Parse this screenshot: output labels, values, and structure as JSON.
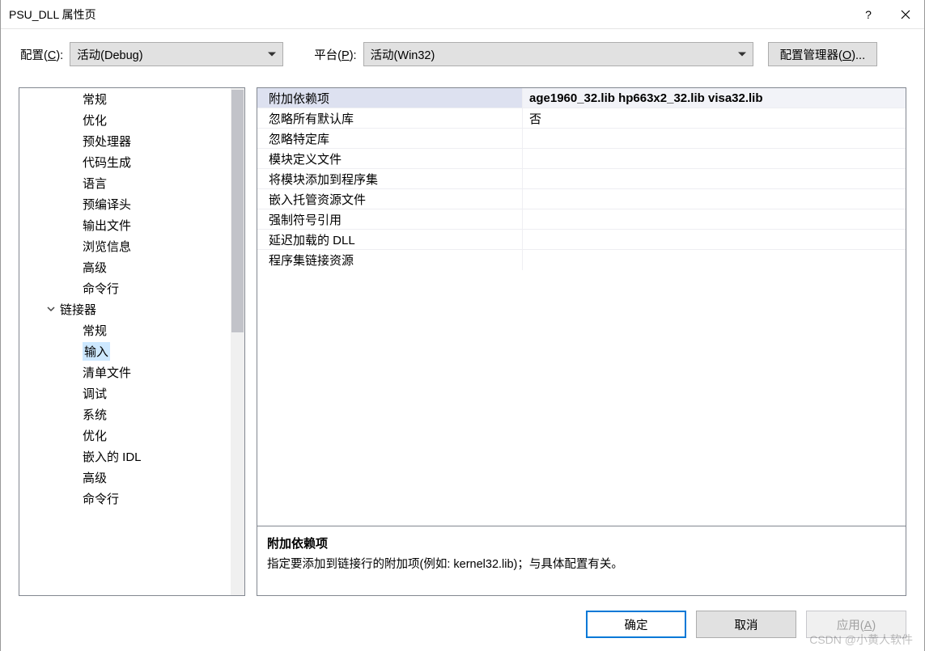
{
  "window": {
    "title": "PSU_DLL 属性页"
  },
  "configbar": {
    "config_label": "配置(C):",
    "config_value": "活动(Debug)",
    "platform_label": "平台(P):",
    "platform_value": "活动(Win32)",
    "config_mgr_button": "配置管理器(O)..."
  },
  "tree": {
    "items_level2": [
      "常规",
      "优化",
      "预处理器",
      "代码生成",
      "语言",
      "预编译头",
      "输出文件",
      "浏览信息",
      "高级",
      "命令行"
    ],
    "group_label": "链接器",
    "items_linker": [
      "常规",
      "输入",
      "清单文件",
      "调试",
      "系统",
      "优化",
      "嵌入的 IDL",
      "高级",
      "命令行"
    ],
    "selected_linker_index": 1
  },
  "properties": {
    "rows": [
      {
        "name": "附加依赖项",
        "value": "age1960_32.lib hp663x2_32.lib visa32.lib",
        "selected": true
      },
      {
        "name": "忽略所有默认库",
        "value": "否"
      },
      {
        "name": "忽略特定库",
        "value": ""
      },
      {
        "name": "模块定义文件",
        "value": ""
      },
      {
        "name": "将模块添加到程序集",
        "value": ""
      },
      {
        "name": "嵌入托管资源文件",
        "value": ""
      },
      {
        "name": "强制符号引用",
        "value": ""
      },
      {
        "name": "延迟加载的 DLL",
        "value": ""
      },
      {
        "name": "程序集链接资源",
        "value": ""
      }
    ]
  },
  "description": {
    "title": "附加依赖项",
    "text": "指定要添加到链接行的附加项(例如: kernel32.lib)；与具体配置有关。"
  },
  "footer": {
    "ok": "确定",
    "cancel": "取消",
    "apply": "应用(A)"
  },
  "watermark": "CSDN @小黄人软件"
}
